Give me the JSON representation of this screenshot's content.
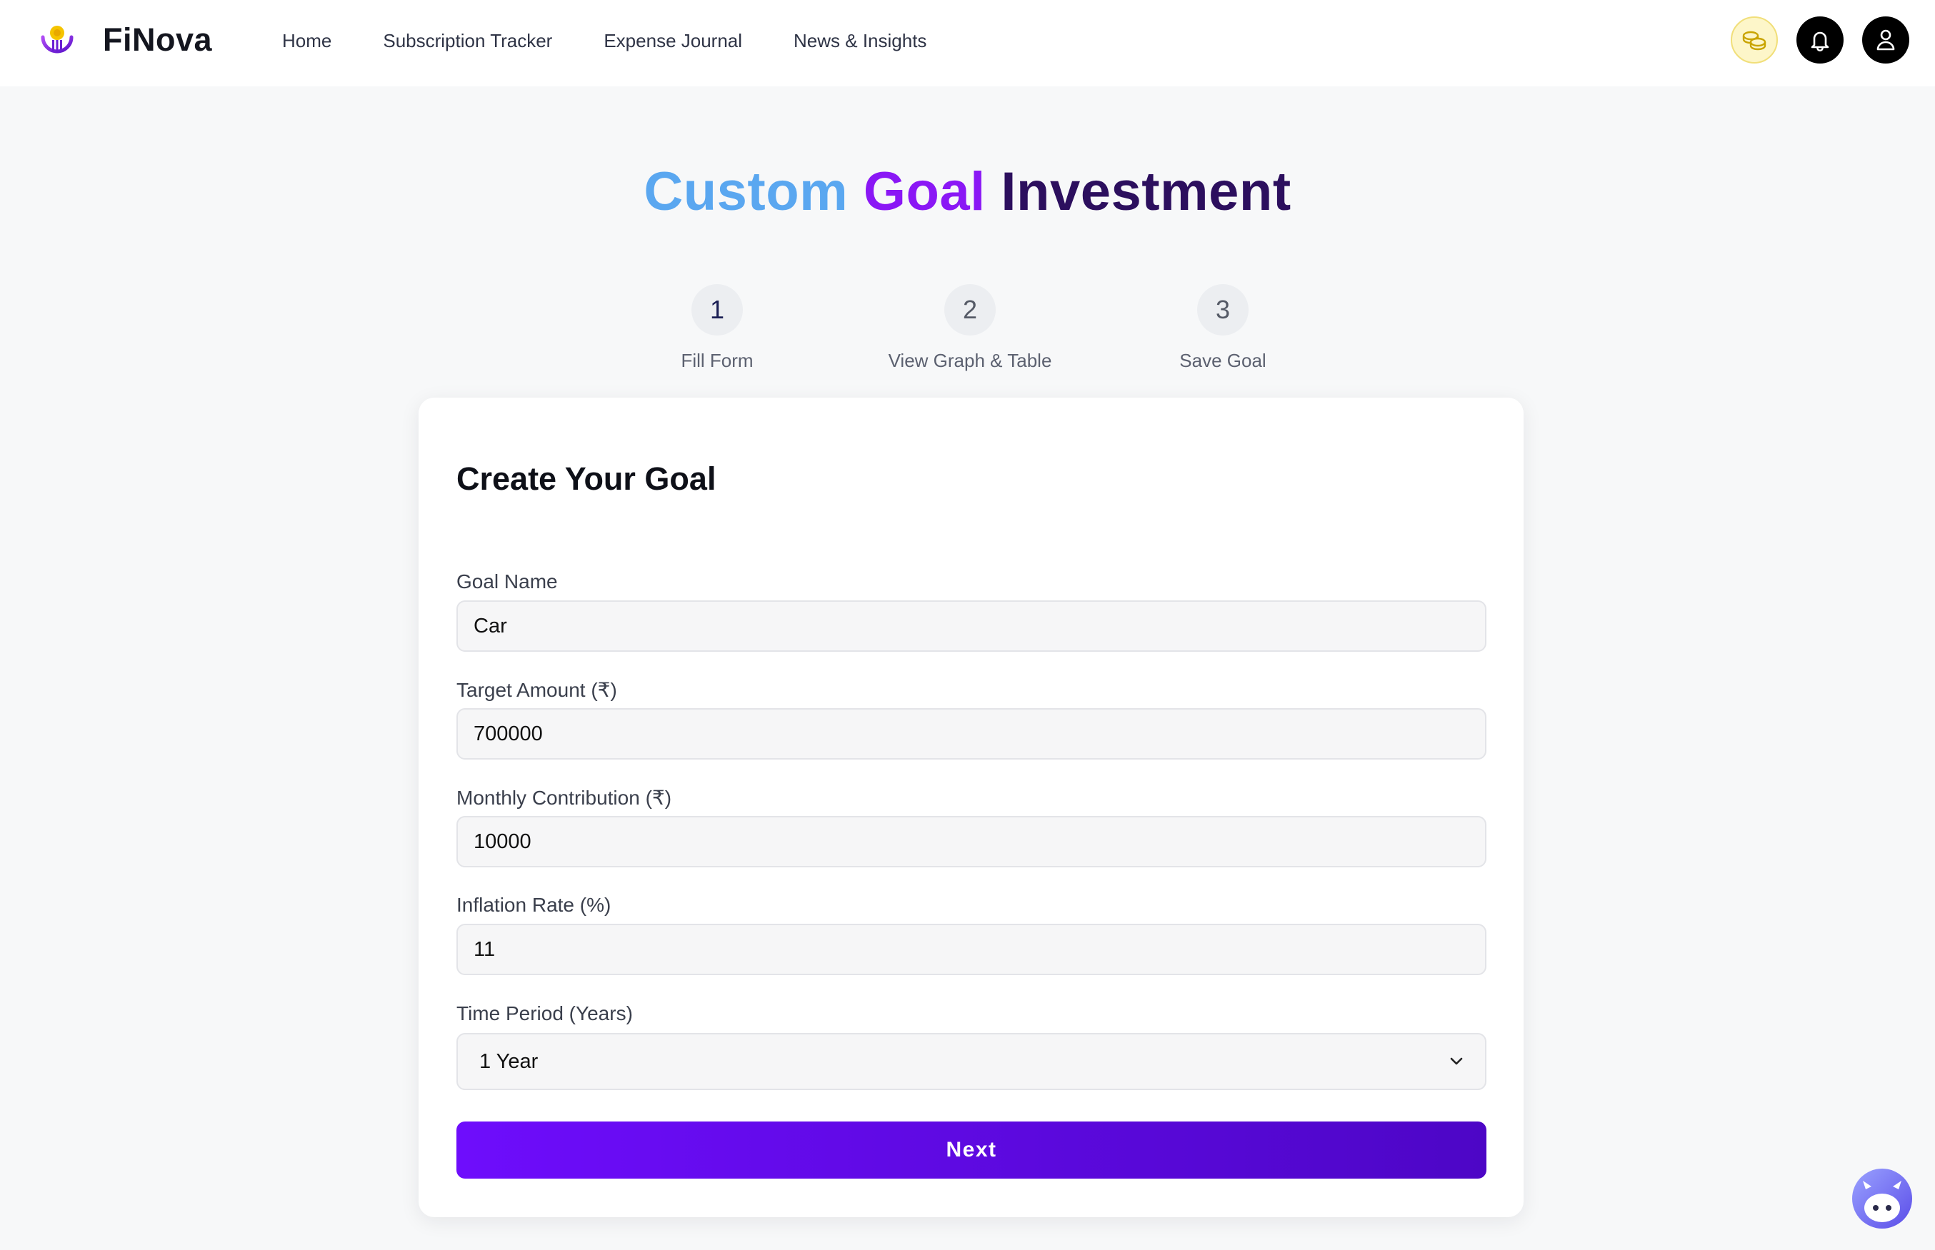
{
  "app": {
    "brand_name": "FiNova",
    "accent_color": "#6e0dfc"
  },
  "nav": {
    "links": [
      "Home",
      "Subscription Tracker",
      "Expense Journal",
      "News & Insights"
    ],
    "icons": [
      "coins-icon",
      "bell-icon",
      "user-icon"
    ]
  },
  "page": {
    "title_part1": "Custom",
    "title_part2": "Goal",
    "title_part3": "Investment"
  },
  "stepper": {
    "steps": [
      {
        "number": "1",
        "label": "Fill Form",
        "active": true
      },
      {
        "number": "2",
        "label": "View Graph & Table",
        "active": false
      },
      {
        "number": "3",
        "label": "Save Goal",
        "active": false
      }
    ]
  },
  "form": {
    "title": "Create Your Goal",
    "goal_name": {
      "label": "Goal Name",
      "value": "Car"
    },
    "target_amount": {
      "label": "Target Amount (₹)",
      "value": "700000"
    },
    "monthly_contribution": {
      "label": "Monthly Contribution (₹)",
      "value": "10000"
    },
    "inflation_rate": {
      "label": "Inflation Rate (%)",
      "value": "11"
    },
    "time_period": {
      "label": "Time Period (Years)",
      "selected": "1 Year"
    },
    "next_label": "Next"
  },
  "chatbot": {
    "icon": "robot-icon"
  }
}
